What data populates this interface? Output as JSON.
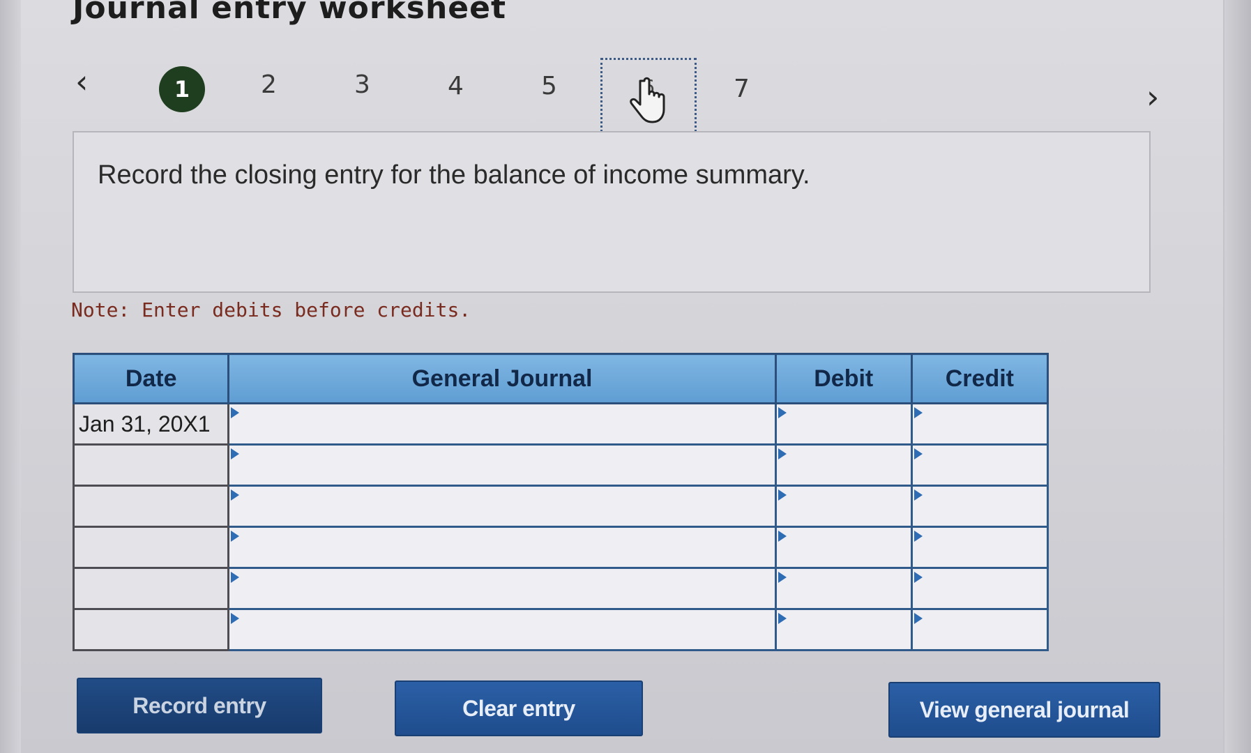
{
  "title": "Journal entry worksheet",
  "pager": {
    "prev_icon": "chevron-left-icon",
    "next_icon": "chevron-right-icon",
    "steps": [
      "1",
      "2",
      "3",
      "4",
      "5",
      "6",
      "7"
    ],
    "active_step": "1",
    "focused_step": "6"
  },
  "question": {
    "text": "Record the closing entry for the balance of income summary."
  },
  "note": "Note: Enter debits before credits.",
  "journal": {
    "headers": {
      "date": "Date",
      "account": "General Journal",
      "debit": "Debit",
      "credit": "Credit"
    },
    "rows": [
      {
        "date": "Jan 31, 20X1",
        "account": "",
        "debit": "",
        "credit": ""
      },
      {
        "date": "",
        "account": "",
        "debit": "",
        "credit": ""
      },
      {
        "date": "",
        "account": "",
        "debit": "",
        "credit": ""
      },
      {
        "date": "",
        "account": "",
        "debit": "",
        "credit": ""
      },
      {
        "date": "",
        "account": "",
        "debit": "",
        "credit": ""
      },
      {
        "date": "",
        "account": "",
        "debit": "",
        "credit": ""
      }
    ]
  },
  "buttons": {
    "record": "Record entry",
    "clear": "Clear entry",
    "view": "View general journal"
  },
  "colors": {
    "header_blue": "#6fa9da",
    "button_blue": "#245597",
    "active_step": "#1f3d1f",
    "note_red": "#7a2b1f"
  }
}
